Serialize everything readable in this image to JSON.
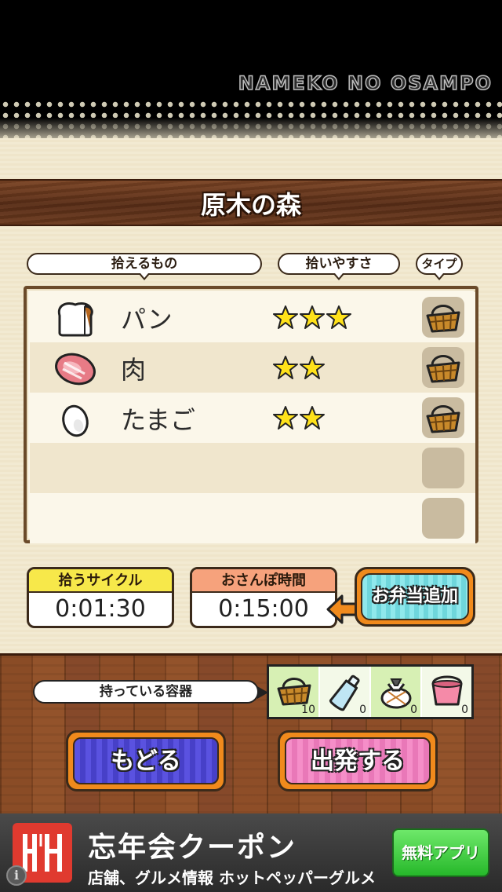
{
  "brand_text": "NAMEKO NO OSAMPO",
  "title": "原木の森",
  "columns": {
    "items": "拾えるもの",
    "ease": "拾いやすさ",
    "type": "タイプ"
  },
  "items": [
    {
      "name": "パン",
      "icon": "bread-icon",
      "stars": 3,
      "type_icon": "basket-icon"
    },
    {
      "name": "肉",
      "icon": "meat-icon",
      "stars": 2,
      "type_icon": "basket-icon"
    },
    {
      "name": "たまご",
      "icon": "egg-icon",
      "stars": 2,
      "type_icon": "basket-icon"
    },
    {
      "name": "",
      "icon": "",
      "stars": 0,
      "type_icon": ""
    },
    {
      "name": "",
      "icon": "",
      "stars": 0,
      "type_icon": ""
    }
  ],
  "cycle": {
    "label": "拾うサイクル",
    "value": "0:01:30"
  },
  "walk_time": {
    "label": "おさんぽ時間",
    "value": "0:15:00"
  },
  "bento_button": "お弁当追加",
  "containers_label": "持っている容器",
  "containers": [
    {
      "icon": "basket-icon",
      "count": "10"
    },
    {
      "icon": "bottle-icon",
      "count": "0"
    },
    {
      "icon": "bundle-icon",
      "count": "0"
    },
    {
      "icon": "bucket-icon",
      "count": "0"
    }
  ],
  "back_button": "もどる",
  "go_button": "出発する",
  "ad": {
    "title": "忘年会クーポン",
    "subtitle": "店舗、グルメ情報 ホットペッパーグルメ",
    "button": "無料アプリ",
    "info": "i"
  },
  "colors": {
    "panel": "#f2ead2",
    "wood": "#8a4c26",
    "accent_orange": "#f08a1c",
    "back_blue": "#5a52e0",
    "go_pink": "#f58ec8",
    "bento_cyan": "#8fe8ec",
    "star": "#ffe21a"
  }
}
